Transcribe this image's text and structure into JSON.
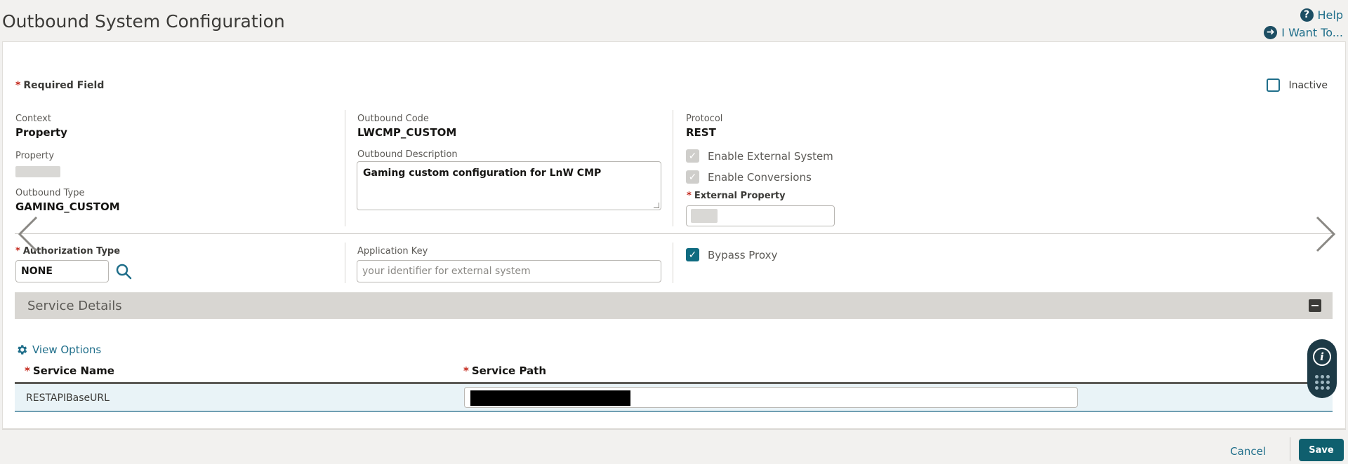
{
  "header": {
    "title": "Outbound System Configuration",
    "help_label": "Help",
    "i_want_to_label": "I Want To..."
  },
  "form": {
    "required_field_label": "Required Field",
    "inactive_label": "Inactive",
    "context_label": "Context",
    "context_value": "Property",
    "property_label": "Property",
    "outbound_type_label": "Outbound Type",
    "outbound_type_value": "GAMING_CUSTOM",
    "outbound_code_label": "Outbound Code",
    "outbound_code_value": "LWCMP_CUSTOM",
    "outbound_description_label": "Outbound Description",
    "outbound_description_value": "Gaming custom configuration for LnW CMP",
    "protocol_label": "Protocol",
    "protocol_value": "REST",
    "enable_external_system_label": "Enable External System",
    "enable_conversions_label": "Enable Conversions",
    "external_property_label": "External Property",
    "authorization_type_label": "Authorization Type",
    "authorization_type_value": "NONE",
    "application_key_label": "Application Key",
    "application_key_placeholder": "your identifier for external system",
    "bypass_proxy_label": "Bypass Proxy"
  },
  "service_details": {
    "section_title": "Service Details",
    "view_options_label": "View Options",
    "columns": [
      "Service Name",
      "Service Path"
    ],
    "rows": [
      {
        "service_name": "RESTAPIBaseURL"
      }
    ]
  },
  "footer": {
    "cancel_label": "Cancel",
    "save_label": "Save"
  },
  "colors": {
    "accent": "#1f6e8a",
    "required": "#c4281c",
    "save_button": "#0f5f6e",
    "section_bar": "#d8d6d2"
  },
  "icons": [
    "help-icon",
    "arrow-right-circle-icon",
    "search-icon",
    "gear-icon",
    "minus-icon",
    "chevron-left-icon",
    "chevron-right-icon",
    "info-icon",
    "grid-dots-icon",
    "check-icon"
  ]
}
